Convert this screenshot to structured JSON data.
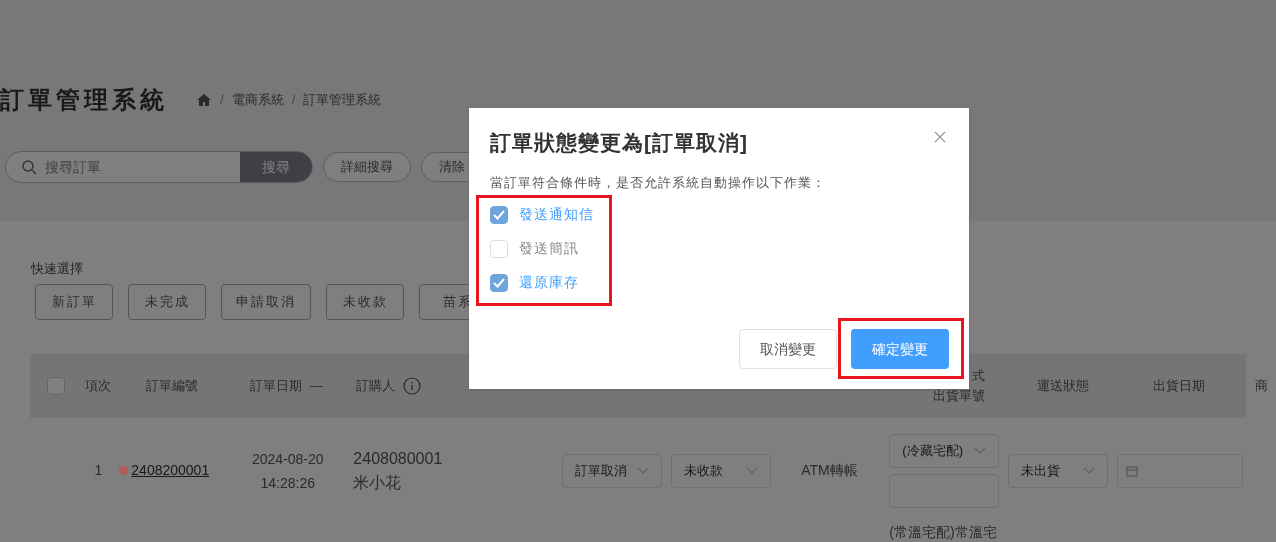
{
  "page": {
    "title": "訂單管理系統",
    "breadcrumb": [
      {
        "separator": "/",
        "label": "電商系統"
      },
      {
        "separator": "/",
        "label": "訂單管理系統"
      }
    ]
  },
  "search": {
    "placeholder": "搜尋訂單",
    "button": "搜尋",
    "actions": [
      "詳細搜尋",
      "清除"
    ]
  },
  "quick_select": {
    "label": "快速選擇",
    "buttons": [
      "新訂單",
      "未完成",
      "申請取消",
      "未收款",
      "苗系"
    ]
  },
  "table": {
    "select_all": {
      "checked": false
    },
    "columns": [
      {
        "label": "項次"
      },
      {
        "label": "訂單編號"
      },
      {
        "label": "訂單日期",
        "sort": "—"
      },
      {
        "label": "訂購人",
        "info": true
      },
      {
        "label": "式",
        "label2": "出貨單號"
      },
      {
        "label": "運送狀態"
      },
      {
        "label": "出貨日期"
      },
      {
        "label": "商"
      }
    ],
    "rows": [
      {
        "index": "1",
        "color": "#b35a5a",
        "order_no": "2408200001",
        "date": "2024-08-20",
        "time": "14:28:26",
        "buyer_id": "2408080001",
        "buyer_name": "米小花",
        "order_status": "訂單取消",
        "payment_status": "未收款",
        "payment_method": "ATM轉帳",
        "shipping_method": "(冷藏宅配)",
        "shipment_no": "",
        "delivery_status": "未出貨",
        "ship_date": ""
      },
      {
        "shipping_method": "(常溫宅配)常溫宅"
      }
    ]
  },
  "dialog": {
    "title": "訂單狀態變更為[訂單取消]",
    "message": "當訂單符合條件時，是否允許系統自動操作以下作業：",
    "options": [
      {
        "label": "發送通知信",
        "checked": true
      },
      {
        "label": "發送簡訊",
        "checked": false
      },
      {
        "label": "還原庫存",
        "checked": true
      }
    ],
    "cancel": "取消變更",
    "confirm": "確定變更"
  }
}
